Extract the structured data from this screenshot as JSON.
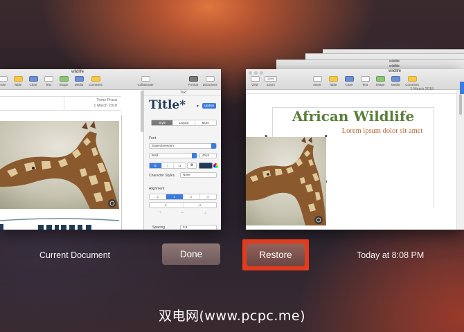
{
  "left_window": {
    "title": "wildlife",
    "toolbar": [
      "nsert",
      "Table",
      "Chart",
      "Text",
      "Shape",
      "Media",
      "Comment",
      "Collaborate",
      "Format",
      "Document"
    ],
    "doc_author": "Trenz Pruca",
    "doc_date": "1 March 2018",
    "sidebar": {
      "header": "Text",
      "style_name": "Title*",
      "update_label": "Update",
      "tabs": [
        "Style",
        "Layout",
        "More"
      ],
      "font_label": "Font",
      "font_name": "Superclarendon",
      "font_weight": "Bold",
      "font_size": "40 pt",
      "bold": "B",
      "italic": "I",
      "underline": "U",
      "char_styles_label": "Character Styles",
      "char_styles_value": "None",
      "alignment_label": "Alignment",
      "spacing_label": "Spacing",
      "spacing_value": "0.8"
    }
  },
  "right_window": {
    "title": "wildlife",
    "toolbar": [
      "View",
      "Zoom",
      "Insert",
      "Table",
      "Chart",
      "Text",
      "Shape",
      "Media",
      "Comment"
    ],
    "zoom_value": "125%",
    "doc_date": "1 March 2018",
    "heading": "African Wildlife",
    "subtitle": "Lorem ipsum dolor sit amet",
    "stacked_titles": [
      "wildlife",
      "wildlife",
      "wildlife"
    ]
  },
  "labels": {
    "current": "Current Document",
    "done": "Done",
    "restore": "Restore",
    "timestamp": "Today at 8:08 PM"
  },
  "watermark": "双电网(www.pcpc.me)",
  "colors": {
    "heading_green": "#5b7f3a",
    "subtitle_brown": "#b5652f",
    "title_blue": "#1f3b56",
    "highlight": "#e23b1e"
  }
}
